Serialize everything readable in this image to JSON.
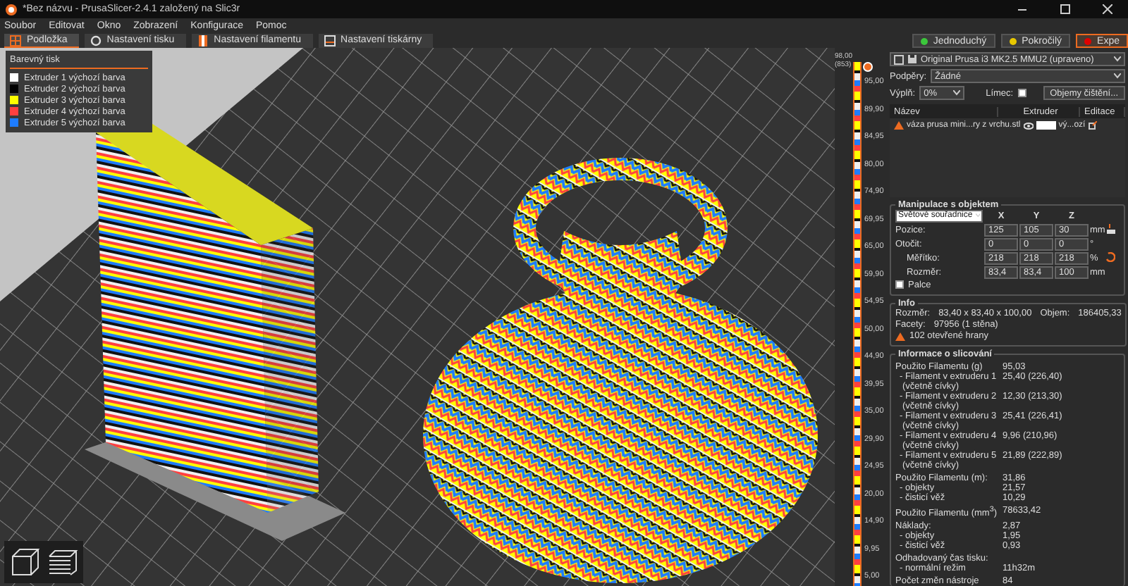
{
  "window": {
    "title": "*Bez názvu - PrusaSlicer-2.4.1 založený na Slic3r"
  },
  "menu": [
    "Soubor",
    "Editovat",
    "Okno",
    "Zobrazení",
    "Konfigurace",
    "Pomoc"
  ],
  "tabs": [
    {
      "label": "Podložka",
      "selected": true
    },
    {
      "label": "Nastavení tisku",
      "selected": false
    },
    {
      "label": "Nastavení filamentu",
      "selected": false
    },
    {
      "label": "Nastavení tiskárny",
      "selected": false
    }
  ],
  "modes": [
    {
      "label": "Jednoduchý",
      "color": "#3cc83c",
      "selected": false
    },
    {
      "label": "Pokročilý",
      "color": "#e8c800",
      "selected": false
    },
    {
      "label": "Expe",
      "color": "#e00000",
      "selected": true
    }
  ],
  "legend": {
    "title": "Barevný tisk",
    "items": [
      {
        "label": "Extruder 1 výchozí barva",
        "color": "#ffffff"
      },
      {
        "label": "Extruder 2 výchozí barva",
        "color": "#000000"
      },
      {
        "label": "Extruder 3 výchozí barva",
        "color": "#ffff00"
      },
      {
        "label": "Extruder 4 výchozí barva",
        "color": "#ff4040"
      },
      {
        "label": "Extruder 5 výchozí barva",
        "color": "#1e7cff"
      }
    ]
  },
  "layer_slider": {
    "top_value": "98,00",
    "top_layer": "(853)",
    "ticks": [
      "95,00",
      "89,90",
      "84,95",
      "80,00",
      "74,90",
      "69,95",
      "65,00",
      "59,90",
      "54,95",
      "50,00",
      "44,90",
      "39,95",
      "35,00",
      "29,90",
      "24,95",
      "20,00",
      "14,90",
      "9,95",
      "5,00"
    ]
  },
  "panel": {
    "printer": "Original Prusa i3 MK2.5 MMU2 (upraveno)",
    "supports": {
      "label": "Podpěry:",
      "value": "Žádné"
    },
    "infill": {
      "label": "Výplň:",
      "value": "0%"
    },
    "brim": {
      "label": "Límec:",
      "checked": false
    },
    "purge_button": "Objemy čištění...",
    "object_list": {
      "columns": [
        "Název",
        "Extruder",
        "Editace"
      ],
      "rows": [
        {
          "name": "váza prusa mini...ry z vrchu.stl",
          "extruder": "vý...ozí"
        }
      ]
    },
    "manipulation": {
      "title": "Manipulace s objektem",
      "coordinates": "Světové souřadnice",
      "axes": [
        "X",
        "Y",
        "Z"
      ],
      "rows": [
        {
          "label": "Pozice:",
          "values": [
            "125",
            "105",
            "30"
          ],
          "unit": "mm"
        },
        {
          "label": "Otočit:",
          "values": [
            "0",
            "0",
            "0"
          ],
          "unit": "°"
        },
        {
          "label": "Měřítko:",
          "values": [
            "218",
            "218",
            "218"
          ],
          "unit": "%"
        },
        {
          "label": "Rozměr:",
          "values": [
            "83,4",
            "83,4",
            "100"
          ],
          "unit": "mm"
        }
      ],
      "inches": {
        "label": "Palce",
        "checked": false
      }
    },
    "info": {
      "title": "Info",
      "size_label": "Rozměr:",
      "size": "83,40 x 83,40 x 100,00",
      "volume_label": "Objem:",
      "volume": "186405,33",
      "facets_label": "Facety:",
      "facets": "97956 (1 stěna)",
      "warning": "102 otevřené hrany"
    },
    "slicing": {
      "title": "Informace o slicování",
      "rows": [
        {
          "kind": "heading",
          "label": "Použito Filamentu (g)",
          "value": "95,03"
        },
        {
          "kind": "item",
          "label": "- Filament v extruderu 1",
          "note": "(včetně cívky)",
          "value": "25,40 (226,40)"
        },
        {
          "kind": "item",
          "label": "- Filament v extruderu 2",
          "note": "(včetně cívky)",
          "value": "12,30 (213,30)"
        },
        {
          "kind": "item",
          "label": "- Filament v extruderu 3",
          "note": "(včetně cívky)",
          "value": "25,41 (226,41)"
        },
        {
          "kind": "item",
          "label": "- Filament v extruderu 4",
          "note": "(včetně cívky)",
          "value": "9,96 (210,96)"
        },
        {
          "kind": "item",
          "label": "- Filament v extruderu 5",
          "note": "(včetně cívky)",
          "value": "21,89 (222,89)"
        },
        {
          "kind": "heading",
          "label": "Použito Filamentu (m):",
          "value": "31,86"
        },
        {
          "kind": "item",
          "label": "- objekty",
          "value": "21,57"
        },
        {
          "kind": "item",
          "label": "- čisticí věž",
          "value": "10,29"
        },
        {
          "kind": "heading",
          "label": "Použito Filamentu (mm$^{3}$)",
          "value": "78633,42"
        },
        {
          "kind": "heading",
          "label": "Náklady:",
          "value": "2,87"
        },
        {
          "kind": "item",
          "label": "- objekty",
          "value": "1,95"
        },
        {
          "kind": "item",
          "label": "- čisticí věž",
          "value": "0,93"
        },
        {
          "kind": "heading",
          "label": "Odhadovaný čas tisku:"
        },
        {
          "kind": "item",
          "label": "- normální režim",
          "value": "11h32m"
        },
        {
          "kind": "heading",
          "label": "Počet změn nástroje",
          "value": "84"
        }
      ]
    }
  }
}
